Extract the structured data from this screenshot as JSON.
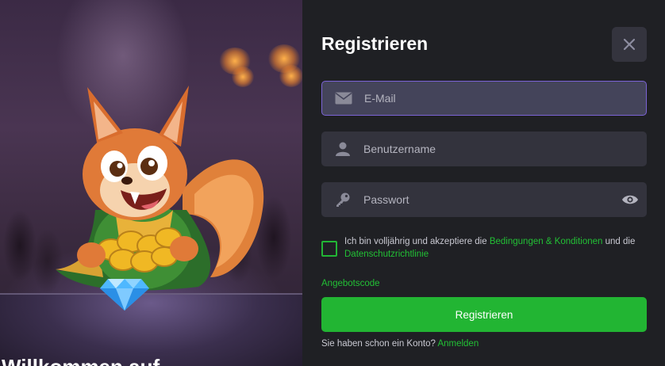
{
  "hero": {
    "welcome_text": "Willkommen auf ..."
  },
  "modal": {
    "title": "Registrieren",
    "close_icon": "close-icon",
    "fields": {
      "email": {
        "placeholder": "E-Mail",
        "value": "",
        "icon": "envelope-icon"
      },
      "username": {
        "placeholder": "Benutzername",
        "value": "",
        "icon": "user-icon"
      },
      "password": {
        "placeholder": "Passwort",
        "value": "",
        "icon": "key-icon",
        "toggle_icon": "eye-icon"
      }
    },
    "consent": {
      "text_before": "Ich bin volljährig und akzeptiere die ",
      "terms_link": "Bedingungen & Konditionen",
      "text_middle": " und die ",
      "privacy_link": "Datenschutzrichtlinie",
      "checked": false
    },
    "promo_code_label": "Angebotscode",
    "submit_label": "Registrieren",
    "login_prompt": "Sie haben schon ein Konto?",
    "login_link": "Anmelden"
  },
  "colors": {
    "accent_green": "#22b533",
    "focus_border": "#7b63d6",
    "panel_bg": "#1f2024",
    "field_bg": "#33333d"
  }
}
